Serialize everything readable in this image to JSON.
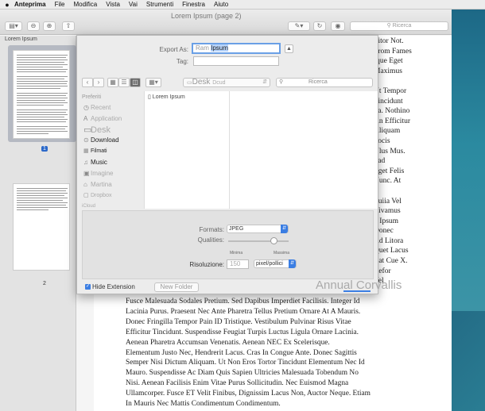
{
  "menubar": {
    "apple": "",
    "items": [
      "Anteprima",
      "File",
      "Modifica",
      "Vista",
      "Vai",
      "Strumenti",
      "Finestra",
      "Aiuto"
    ]
  },
  "window": {
    "title": "Lorem Ipsum (page 2)",
    "search_placeholder": "Ricerca",
    "sidebar_header": "Lorem Ipsum",
    "page_numbers": [
      "1",
      "2"
    ]
  },
  "sheet": {
    "export_as_label": "Export As:",
    "export_as_value_prefix": "Ram",
    "export_as_value_selected": "Ipsum",
    "tag_label": "Tag:",
    "location": "Desk",
    "location_suffix": "Dcud",
    "search_placeholder": "Ricerca",
    "sidebar_header": "Preferiti",
    "sidebar_items": [
      {
        "icon": "clock-icon",
        "glyph": "◷",
        "label": "Recent"
      },
      {
        "icon": "applications-icon",
        "glyph": "A",
        "label": "Application"
      },
      {
        "icon": "desktop-icon",
        "glyph": "▭",
        "label": "Desk"
      },
      {
        "icon": "downloads-icon",
        "glyph": "⊙",
        "label": "Download"
      },
      {
        "icon": "movies-icon",
        "glyph": "▦",
        "label": "Filmati"
      },
      {
        "icon": "music-icon",
        "glyph": "♫",
        "label": "Music"
      },
      {
        "icon": "pictures-icon",
        "glyph": "▣",
        "label": "Imagine"
      },
      {
        "icon": "home-icon",
        "glyph": "⌂",
        "label": "Martina"
      },
      {
        "icon": "dropbox-icon",
        "glyph": "▢",
        "label": "Dropbox"
      }
    ],
    "icloud_label": "iCloud",
    "file_item": "Lorem Ipsum",
    "format_label": "Formats:",
    "format_value": "JPEG",
    "quality_label": "Qualities:",
    "quality_min": "Minima",
    "quality_max": "Massima",
    "quality_level": 0.75,
    "resolution_label": "Risoluzione:",
    "resolution_value": "150",
    "resolution_unit": "pixel/pollici",
    "hide_extension": "Hide Extension",
    "new_folder": "New Folder",
    "annual": "Annual Corvallis"
  },
  "document": {
    "right_lines": [
      "Titor Not.",
      "From Fames",
      "Ique Eget",
      "Maximus",
      "",
      "Ut Tempor",
      "Tincidunt",
      "Sa. Nothino",
      "An Efficitur",
      "Aliquam",
      "Socis",
      "Ulus Mus.",
      "Sad",
      "Eget Felis",
      "Nunc. At",
      "",
      "Luiia Vel",
      "Vivamus",
      "P Ipsum",
      "Donec",
      "Ad Litora",
      "Quet Lacus",
      "Rat Cue X.",
      "Refor",
      "Vel"
    ],
    "bottom_lines": [
      "Fusce Malesuada Sodales Pretium. Sed Dapibus Imperdiet Facilisis. Integer Id",
      "Lacinia Purus. Praesent Nec Ante Pharetra Tellus Pretium Ornare At A Mauris.",
      "Donec Fringilla Tempor Pain ID Tristique. Vestibulum Pulvinar Risus Vitae",
      "Efficitur Tincidunt. Suspendisse Feugiat Turpis Luctus Ligula Ornare Lacinia.",
      "Aenean Pharetra Accumsan Venenatis. Aenean NEC Ex Scelerisque.",
      "Elementum Justo Nec, Hendrerit Lacus. Cras In Congue Ante. Donec Sagittis",
      "Semper Nisi Dictum Aliquam. Ut Non Eros Tortor Tincidunt Elementum Nec Id",
      "Mauro. Suspendisse Ac Diam Quis Sapien Ultricies Malesuada Tobendum No",
      "Nisi. Aenean Facilisis Enim Vitae Purus Sollicitudin. Nec Euismod Magna",
      "Ullamcorper. Fusce ET Velit Finibus, Dignissim Lacus Non, Auctor Neque. Etiam",
      "In Mauris Nec Mattis Condimentum Condimentum."
    ]
  }
}
